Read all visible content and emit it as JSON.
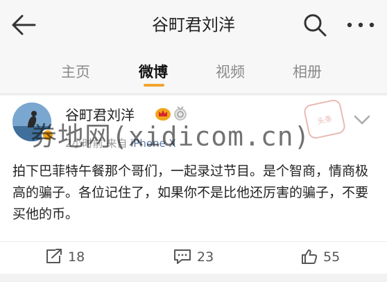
{
  "header": {
    "title": "谷町君刘洋",
    "back_icon": "arrow-left-icon",
    "search_icon": "search-icon",
    "more_icon": "more-horizontal-icon"
  },
  "tabs": [
    {
      "label": "主页",
      "active": false
    },
    {
      "label": "微博",
      "active": true
    },
    {
      "label": "视频",
      "active": false
    },
    {
      "label": "相册",
      "active": false
    }
  ],
  "accent_color": "#f2a32e",
  "post": {
    "author": "谷町君刘洋",
    "time": "2小时前",
    "source_prefix": "来自",
    "device": "iPhone X",
    "text": "拍下巴菲特午餐那个哥们，一起录过节目。是个智商，情商极高的骗子。各位记住了，如果你不是比他还厉害的骗子，不要买他的币。",
    "stamp_text": "头条"
  },
  "actions": {
    "repost_count": "18",
    "comment_count": "23",
    "like_count": "55"
  },
  "watermark": "券地网(xidicom.cn)"
}
